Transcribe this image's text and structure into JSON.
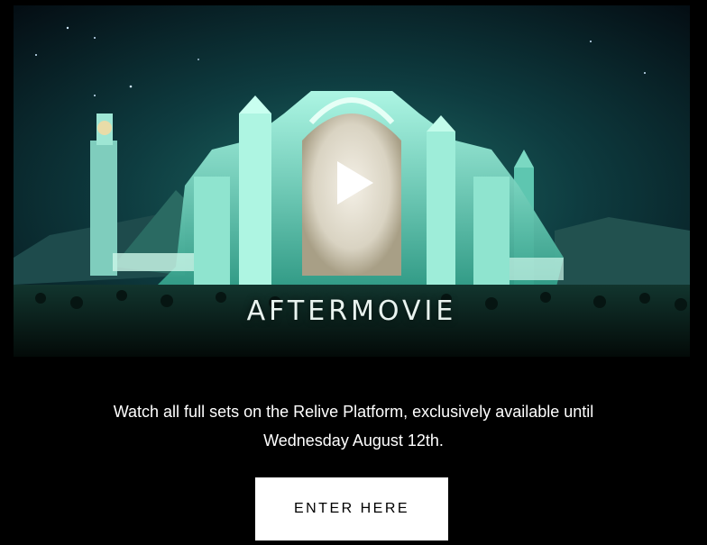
{
  "video": {
    "title": "AFTERMOVIE",
    "play_icon": "play-icon"
  },
  "description": {
    "line1": "Watch all full sets on the Relive Platform, exclusively available until",
    "line2": "Wednesday August 12th."
  },
  "cta": {
    "label": "ENTER HERE"
  },
  "colors": {
    "background": "#000000",
    "scene_glow": "#4fe3c1",
    "button_bg": "#ffffff",
    "button_text": "#000000"
  }
}
